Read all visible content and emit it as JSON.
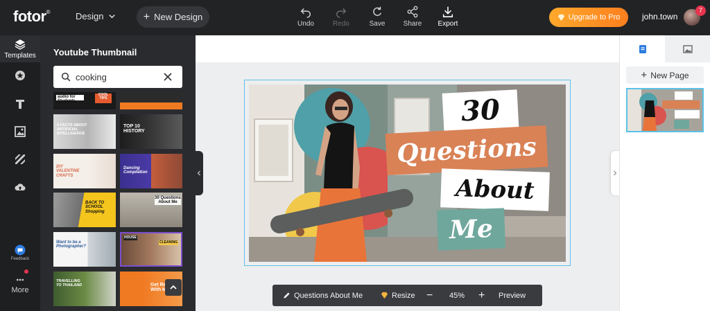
{
  "brand": {
    "logo_text": "fotor",
    "logo_mark": "®"
  },
  "topbar": {
    "design_menu_label": "Design",
    "new_design_label": "New Design",
    "tools": [
      {
        "label": "Undo",
        "icon": "undo-icon"
      },
      {
        "label": "Redo",
        "icon": "redo-icon"
      },
      {
        "label": "Save",
        "icon": "save-icon"
      },
      {
        "label": "Share",
        "icon": "share-icon"
      },
      {
        "label": "Export",
        "icon": "export-icon"
      }
    ],
    "upgrade_label": "Upgrade to Pro",
    "username": "john.town",
    "notification_count": "7"
  },
  "rail": {
    "items": [
      {
        "label": "Templates",
        "icon": "layers-icon"
      },
      {
        "label": "",
        "icon": "star-icon"
      },
      {
        "label": "",
        "icon": "text-icon"
      },
      {
        "label": "",
        "icon": "image-icon"
      },
      {
        "label": "",
        "icon": "pattern-icon"
      },
      {
        "label": "",
        "icon": "upload-icon"
      }
    ],
    "feedback_label": "Feedback",
    "more_label": "More"
  },
  "templates_panel": {
    "title": "Youtube Thumbnail",
    "search_value": "cooking",
    "thumbnails": [
      {
        "text": "audio for Students",
        "badge": "COOL TIPS"
      },
      {
        "text": ""
      },
      {
        "text": "4 FACTS ABOUT ARTIFICIAL INTELLIGENCE"
      },
      {
        "text": "TOP 10 HISTORY"
      },
      {
        "text": "DIY VALENTINE CRAFTS"
      },
      {
        "text": "Dancing Compilation"
      },
      {
        "text": "BACK TO SCHOOL Shopping"
      },
      {
        "text": "30 Questions About Me"
      },
      {
        "text": "Want to be a Photographer?"
      },
      {
        "text": "HOUSE",
        "badge": "CLEANING"
      },
      {
        "text": "TRAVELLING TO THAILAND"
      },
      {
        "text": "Get Ready With Me"
      }
    ]
  },
  "canvas": {
    "line1": "30",
    "line2": "Questions",
    "line3": "About",
    "line4": "Me",
    "colors": {
      "orange": "#d98256",
      "teal": "#6fa79c",
      "white": "#ffffff"
    }
  },
  "bottom_toolbar": {
    "design_name": "Questions About Me",
    "resize_label": "Resize",
    "zoom_out": "−",
    "zoom_value": "45%",
    "zoom_in": "+",
    "preview_label": "Preview"
  },
  "right_panel": {
    "new_page_label": "New Page",
    "tabs": [
      "pages-icon",
      "image-icon"
    ]
  },
  "colors": {
    "topbar": "#222325",
    "panel": "#2a2b2e",
    "accent": "#5bc2e7",
    "upgrade_start": "#ffa92c",
    "upgrade_end": "#fd7f1f"
  }
}
